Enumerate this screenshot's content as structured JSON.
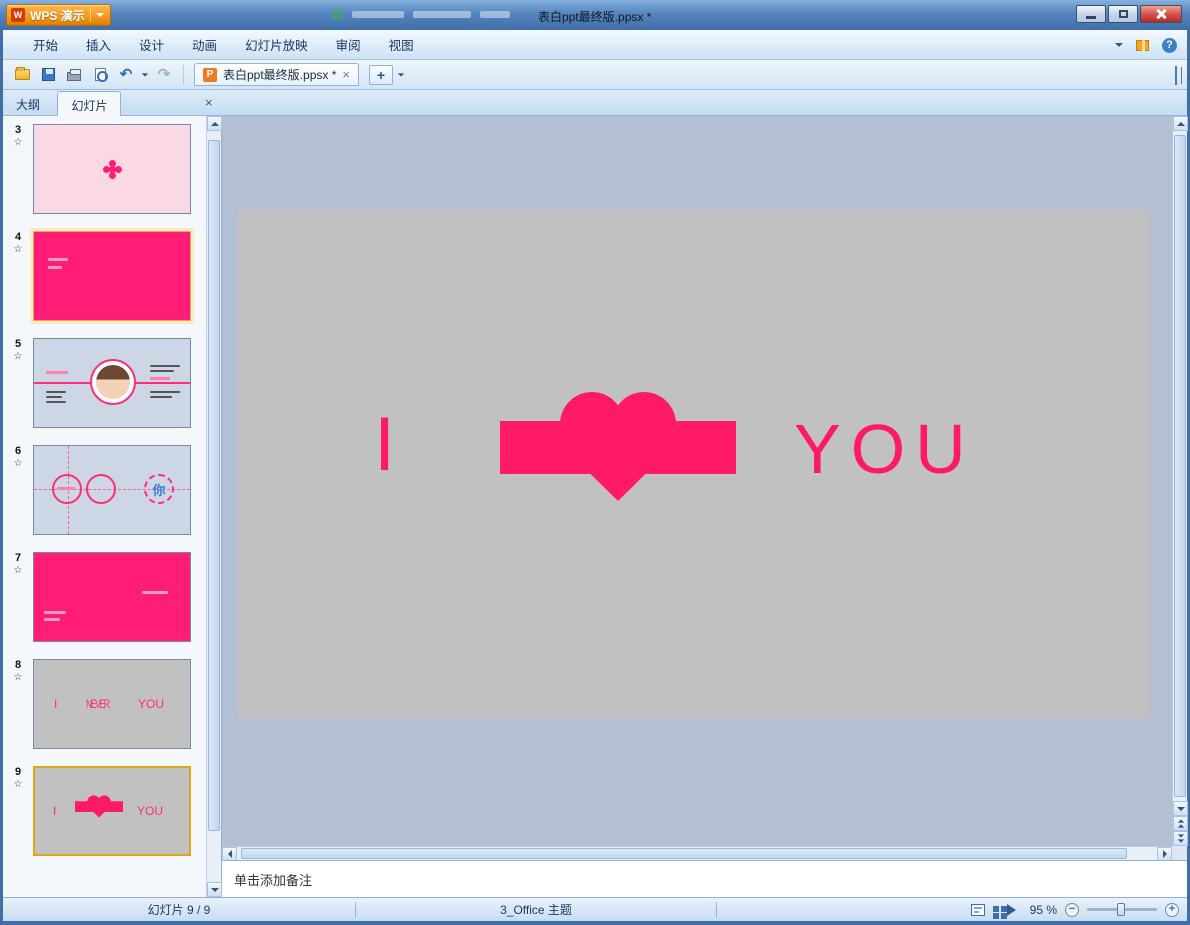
{
  "window": {
    "app_button": "WPS 演示",
    "title": "表白ppt最终版.ppsx *"
  },
  "menu": {
    "items": [
      "开始",
      "插入",
      "设计",
      "动画",
      "幻灯片放映",
      "审阅",
      "视图"
    ]
  },
  "toolbar": {
    "document_tab": "表白ppt最终版.ppsx *"
  },
  "panel": {
    "outline_tab": "大纲",
    "slides_tab": "幻灯片"
  },
  "icons": {
    "close_x": "×",
    "plus": "+",
    "undo": "↶",
    "redo": "↷",
    "help": "?",
    "animation_star": "☆",
    "zoom_out": "−",
    "zoom_in": "+",
    "wps_logo": "W",
    "doc": "P"
  },
  "slides": [
    {
      "number": "3"
    },
    {
      "number": "4"
    },
    {
      "number": "5"
    },
    {
      "number": "6",
      "text": "你"
    },
    {
      "number": "7"
    },
    {
      "number": "8",
      "left": "I",
      "middle": "NEVER",
      "right": "YOU"
    },
    {
      "number": "9",
      "left": "I",
      "right": "YOU"
    }
  ],
  "slide_canvas": {
    "left_text": "I",
    "right_text": "YOU"
  },
  "notes": {
    "placeholder": "单击添加备注"
  },
  "statusbar": {
    "slide_indicator": "幻灯片 9 / 9",
    "theme": "3_Office 主题",
    "zoom": "95 %"
  },
  "colors": {
    "accent_pink": "#ff1a66",
    "magenta_slide": "#ff1d75",
    "wps_orange": "#f59a23",
    "titlebar_blue": "#4a7ab5"
  }
}
